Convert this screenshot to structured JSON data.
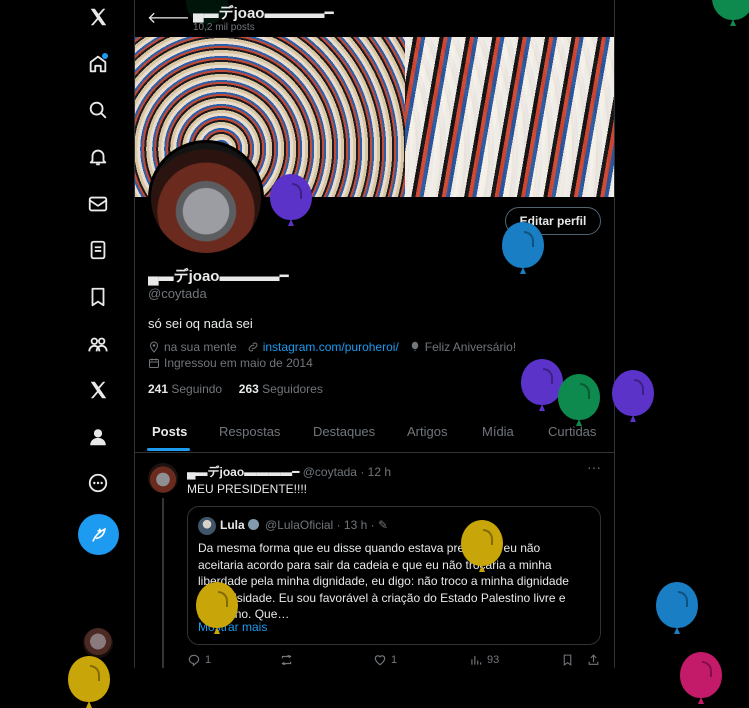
{
  "profile": {
    "display_name": "▄▬デjoao▬▬▬▬━",
    "post_count": "10,2 mil posts",
    "handle": "@coytada",
    "bio": "só sei oq nada sei",
    "location": "na sua mente",
    "website": "instagram.com/puroheroi/",
    "birthday": "Feliz Aniversário!",
    "joined": "Ingressou em maio de 2014",
    "following_count": "241",
    "following_label": "Seguindo",
    "followers_count": "263",
    "followers_label": "Seguidores",
    "edit_button": "Editar perfil"
  },
  "tabs": [
    "Posts",
    "Respostas",
    "Destaques",
    "Artigos",
    "Mídia",
    "Curtidas"
  ],
  "tweet": {
    "author_name": "▄▬デjoao▬▬▬▬━",
    "author_handle": "@coytada",
    "time": "· 12 h",
    "more": "···",
    "text": "MEU PRESIDENTE!!!!",
    "quote": {
      "author_name": "Lula",
      "author_handle": "@LulaOficial",
      "time": "· 13 h ·",
      "text": "Da mesma forma que eu disse quando estava preso que eu não aceitaria acordo para sair da cadeia e que eu não trocaria a minha liberdade pela minha dignidade, eu digo: não troco a minha dignidade pela falsidade. Eu sou favorável à criação do Estado Palestino livre e soberano. Que…",
      "show_more": "Mostrar mais"
    },
    "actions": {
      "replies": "1",
      "reposts": "",
      "likes": "1",
      "views": "93"
    }
  },
  "colors": {
    "accent": "#1d9bf0",
    "background": "#000000",
    "muted": "#71767b",
    "border": "#2f3336",
    "balloon_green": "#0f8a4e",
    "balloon_blue": "#1a7ec4",
    "balloon_purple": "#5b33c9",
    "balloon_yellow": "#c8a508",
    "balloon_pink": "#c41a6a"
  },
  "nav_icons": [
    "x-logo-icon",
    "home-icon",
    "search-icon",
    "bell-icon",
    "mail-icon",
    "list-icon",
    "bookmark-icon",
    "communities-icon",
    "x-premium-icon",
    "profile-icon",
    "more-icon",
    "post-icon"
  ]
}
